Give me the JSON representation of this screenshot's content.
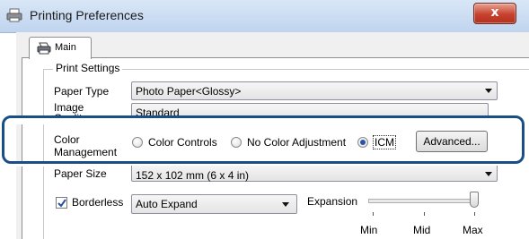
{
  "window": {
    "title": "Printing Preferences",
    "close_label": "x"
  },
  "tabs": [
    {
      "label": "Main"
    }
  ],
  "print_settings": {
    "legend": "Print Settings",
    "paper_type": {
      "label": "Paper Type",
      "value": "Photo Paper<Glossy>"
    },
    "image_quality": {
      "label_line1": "Image",
      "label_line2": "Quality",
      "value": "Standard"
    },
    "color_management": {
      "label_line1": "Color",
      "label_line2": "Management",
      "options": [
        "Color Controls",
        "No Color Adjustment",
        "ICM"
      ],
      "selected": "ICM",
      "advanced_label": "Advanced..."
    },
    "paper_size": {
      "label": "Paper Size",
      "value": "152 x 102 mm (6 x 4 in)"
    },
    "borderless": {
      "label": "Borderless",
      "checked": true,
      "mode_value": "Auto Expand",
      "expansion_label": "Expansion",
      "expansion_level": "Max",
      "tick_labels": [
        "Min",
        "Mid",
        "Max"
      ]
    }
  },
  "icons": [
    "printer-icon",
    "close-icon",
    "printer-tab-icon",
    "dropdown-arrow-icon",
    "checkmark-icon"
  ],
  "colors": {
    "highlight_border": "#1a4f86",
    "selected_radio": "#2a55a6",
    "close_button": "#c7412e"
  }
}
